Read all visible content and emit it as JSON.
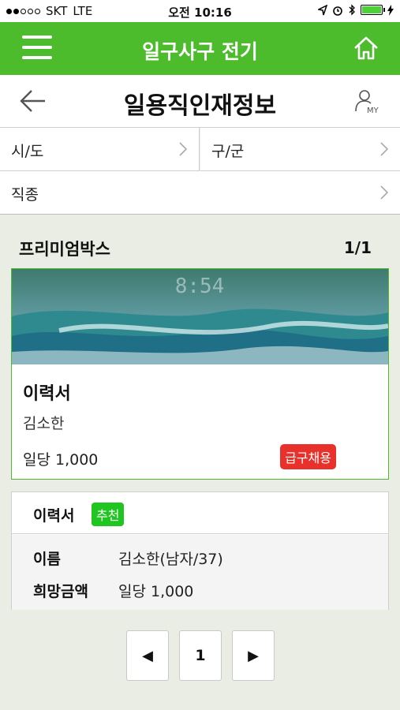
{
  "status_bar": {
    "carrier": "SKT",
    "network": "LTE",
    "time": "오전 10:16"
  },
  "app_bar": {
    "title": "일구사구 전기"
  },
  "title_bar": {
    "title": "일용직인재정보",
    "my_label": "MY"
  },
  "filters": {
    "region": "시/도",
    "district": "구/군",
    "job_type": "직종"
  },
  "premium": {
    "heading": "프리미엄박스",
    "count": "1/1",
    "image_time": "8:54",
    "card": {
      "title": "이력서",
      "name": "김소한",
      "wage": "일당 1,000",
      "badge": "급구채용"
    }
  },
  "resume": {
    "title": "이력서",
    "badge": "추천",
    "name_label": "이름",
    "name_value": "김소한(남자/37)",
    "wage_label": "희망금액",
    "wage_value": "일당 1,000"
  },
  "pagination": {
    "prev": "◀",
    "current": "1",
    "next": "▶"
  },
  "colors": {
    "brand_green": "#4cbb2c",
    "urgent_red": "#e8312a",
    "recommend_green": "#21c521"
  }
}
